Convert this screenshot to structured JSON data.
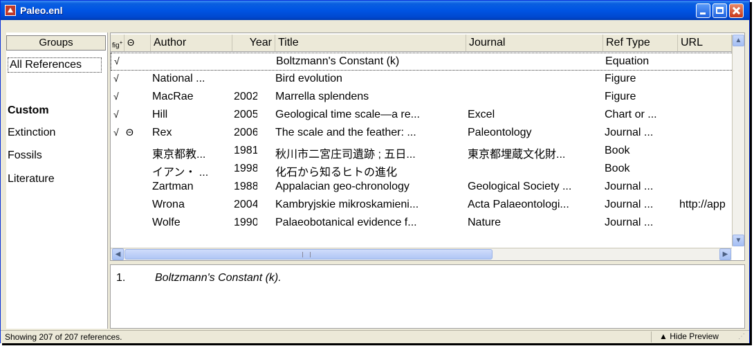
{
  "window": {
    "title": "Paleo.enl"
  },
  "groups": {
    "header": "Groups",
    "all": "All References",
    "custom_heading": "Custom",
    "items": [
      "Extinction",
      "Fossils",
      "Literature"
    ]
  },
  "columns": {
    "figure": "fig",
    "attachment": "Θ",
    "author": "Author",
    "year": "Year",
    "title": "Title",
    "journal": "Journal",
    "ref_type": "Ref Type",
    "url": "URL"
  },
  "rows": [
    {
      "fig": "√",
      "att": "",
      "author": "",
      "year": "",
      "title": "Boltzmann's Constant (k)",
      "journal": "",
      "ref_type": "Equation",
      "url": ""
    },
    {
      "fig": "√",
      "att": "",
      "author": "National ...",
      "year": "",
      "title": "Bird evolution",
      "journal": "",
      "ref_type": "Figure",
      "url": ""
    },
    {
      "fig": "√",
      "att": "",
      "author": "MacRae",
      "year": "2002",
      "title": "Marrella splendens",
      "journal": "",
      "ref_type": "Figure",
      "url": ""
    },
    {
      "fig": "√",
      "att": "",
      "author": "Hill",
      "year": "2005",
      "title": "Geological time scale—a re...",
      "journal": "Excel",
      "ref_type": "Chart or ...",
      "url": ""
    },
    {
      "fig": "√",
      "att": "Θ",
      "author": "Rex",
      "year": "2006",
      "title": "The scale and the feather: ...",
      "journal": "Paleontology",
      "ref_type": "Journal ...",
      "url": ""
    },
    {
      "fig": "",
      "att": "",
      "author": "東京都教...",
      "year": "1981",
      "title": "秋川市二宮庄司遺跡 ; 五日...",
      "journal": "東京都埋蔵文化財...",
      "ref_type": "Book",
      "url": ""
    },
    {
      "fig": "",
      "att": "",
      "author": "イアン・ ...",
      "year": "1998",
      "title": "化石から知るヒトの進化",
      "journal": "",
      "ref_type": "Book",
      "url": ""
    },
    {
      "fig": "",
      "att": "",
      "author": "Zartman",
      "year": "1988",
      "title": "Appalacian geo-chronology",
      "journal": "Geological Society ...",
      "ref_type": "Journal ...",
      "url": ""
    },
    {
      "fig": "",
      "att": "",
      "author": "Wrona",
      "year": "2004",
      "title": "Kambryjskie mikroskamieni...",
      "journal": "Acta Palaeontologi...",
      "ref_type": "Journal ...",
      "url": "http://app"
    },
    {
      "fig": "",
      "att": "",
      "author": "Wolfe",
      "year": "1990",
      "title": "Palaeobotanical evidence f...",
      "journal": "Nature",
      "ref_type": "Journal ...",
      "url": ""
    }
  ],
  "preview": {
    "number": "1.",
    "text": "Boltzmann's Constant (k)."
  },
  "status": {
    "text": "Showing 207 of 207 references.",
    "hide_preview": "Hide Preview"
  }
}
